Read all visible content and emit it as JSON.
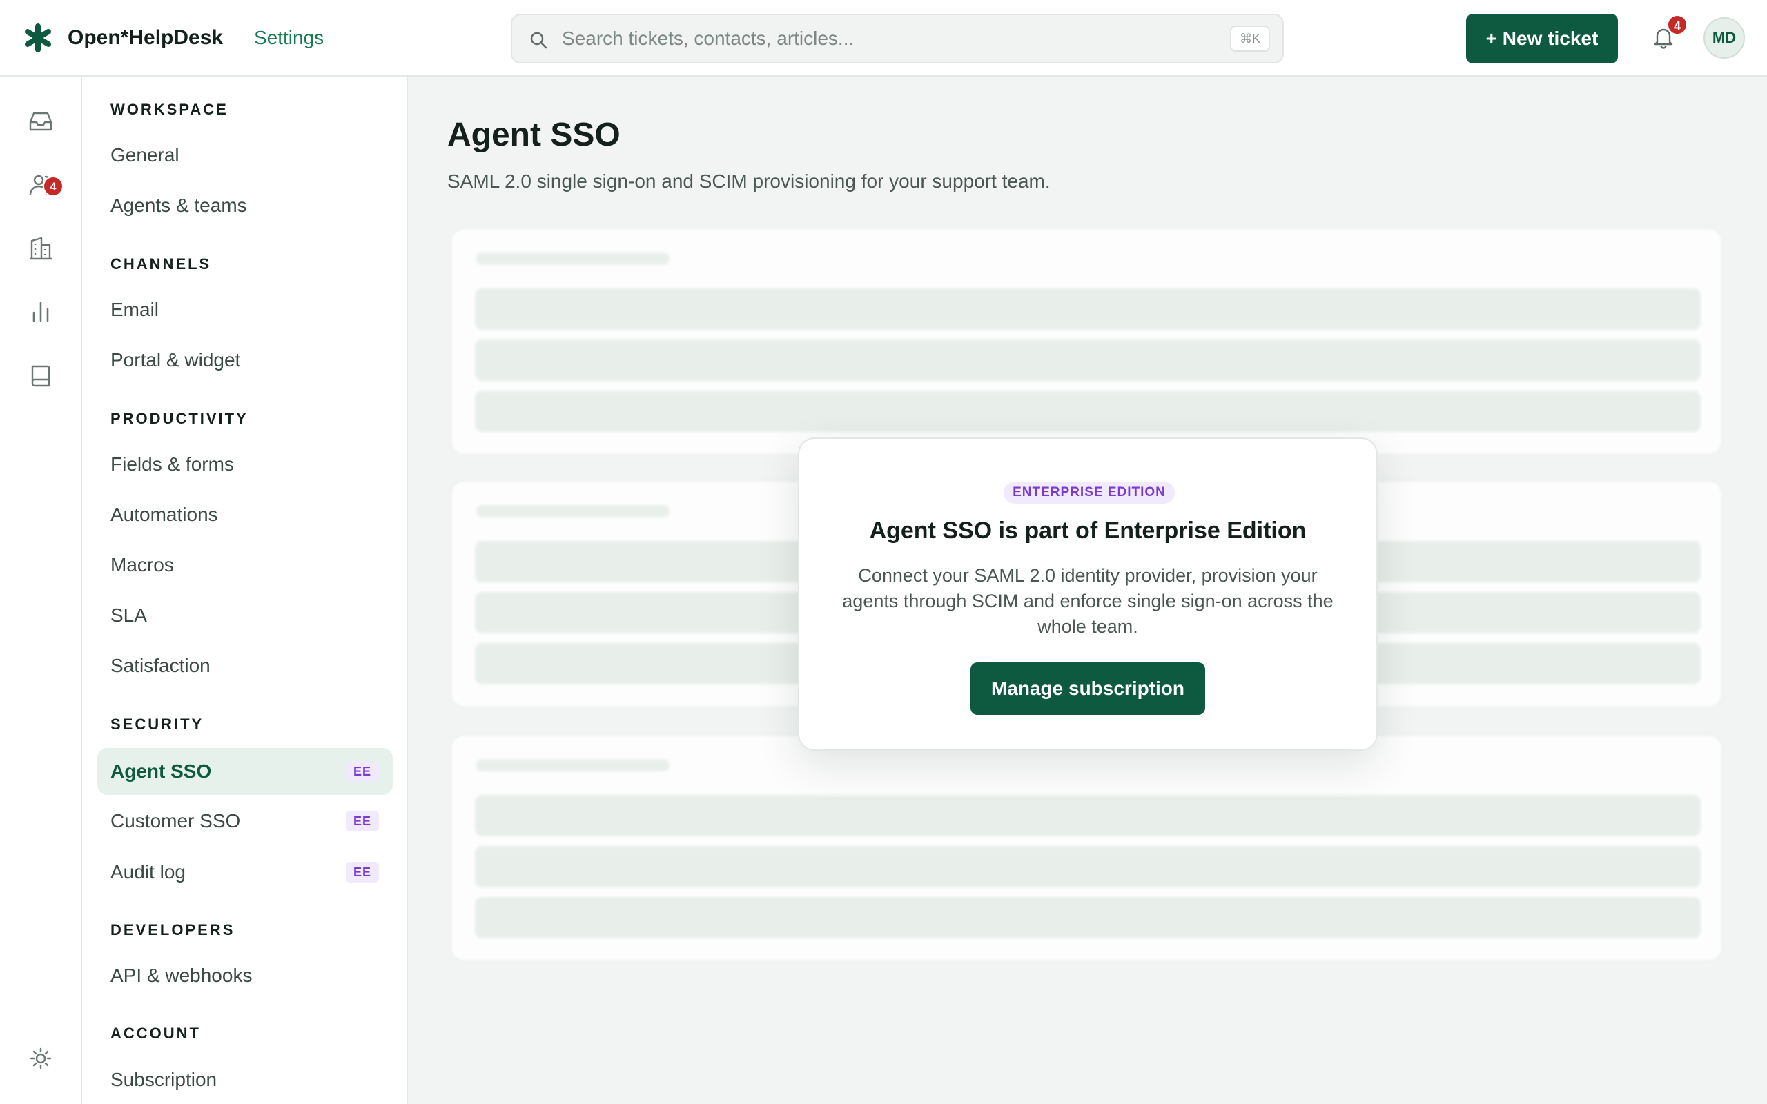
{
  "app": {
    "name": "Open*HelpDesk",
    "section": "Settings",
    "brand_color": "#0e5a41"
  },
  "search": {
    "placeholder": "Search tickets, contacts, articles...",
    "shortcut": "⌘K"
  },
  "header": {
    "new_ticket_label": "+ New ticket",
    "notifications_count": "4",
    "avatar_initials": "MD"
  },
  "rail": {
    "inbox_badge": "4",
    "icons": [
      "inbox-icon",
      "contacts-icon",
      "companies-icon",
      "reports-icon",
      "knowledge-base-icon",
      "theme-toggle-icon"
    ]
  },
  "sidebar": {
    "sections": [
      {
        "title": "WORKSPACE",
        "items": [
          {
            "label": "General"
          },
          {
            "label": "Agents & teams"
          }
        ]
      },
      {
        "title": "CHANNELS",
        "items": [
          {
            "label": "Email"
          },
          {
            "label": "Portal & widget"
          }
        ]
      },
      {
        "title": "PRODUCTIVITY",
        "items": [
          {
            "label": "Fields & forms"
          },
          {
            "label": "Automations"
          },
          {
            "label": "Macros"
          },
          {
            "label": "SLA"
          },
          {
            "label": "Satisfaction"
          }
        ]
      },
      {
        "title": "SECURITY",
        "items": [
          {
            "label": "Agent SSO",
            "badge": "EE",
            "active": true
          },
          {
            "label": "Customer SSO",
            "badge": "EE"
          },
          {
            "label": "Audit log",
            "badge": "EE"
          }
        ]
      },
      {
        "title": "DEVELOPERS",
        "items": [
          {
            "label": "API & webhooks"
          }
        ]
      },
      {
        "title": "ACCOUNT",
        "items": [
          {
            "label": "Subscription"
          }
        ]
      }
    ]
  },
  "main": {
    "title": "Agent SSO",
    "subtitle": "SAML 2.0 single sign-on and SCIM provisioning for your support team."
  },
  "modal": {
    "pill": "ENTERPRISE EDITION",
    "title": "Agent SSO is part of Enterprise Edition",
    "body": "Connect your SAML 2.0 identity provider, provision your agents through SCIM and enforce single sign-on across the whole team.",
    "button": "Manage subscription"
  }
}
